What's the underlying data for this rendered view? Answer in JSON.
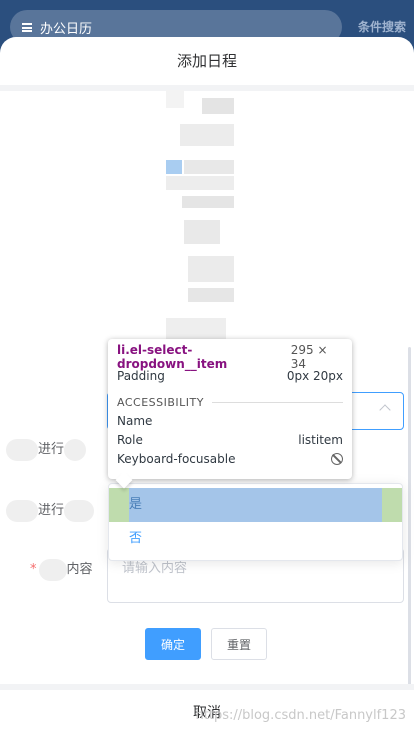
{
  "app": {
    "search_label": "办公日历",
    "condition_search": "条件搜索"
  },
  "sheet": {
    "title": "添加日程",
    "cancel": "取消"
  },
  "form": {
    "label_progress_1": "进行",
    "label_progress_2": "进行",
    "label_content": "内容",
    "content_placeholder": "请输入内容",
    "options": [
      "是",
      "否"
    ],
    "confirm": "确定",
    "reset": "重置"
  },
  "tooltip": {
    "selector": "li.el-select-dropdown__item",
    "size": "295 × 34",
    "padding_label": "Padding",
    "padding_value": "0px 20px",
    "section": "ACCESSIBILITY",
    "name_label": "Name",
    "role_label": "Role",
    "role_value": "listitem",
    "focusable_label": "Keyboard-focusable"
  },
  "watermark": "https://blog.csdn.net/Fannylf123"
}
